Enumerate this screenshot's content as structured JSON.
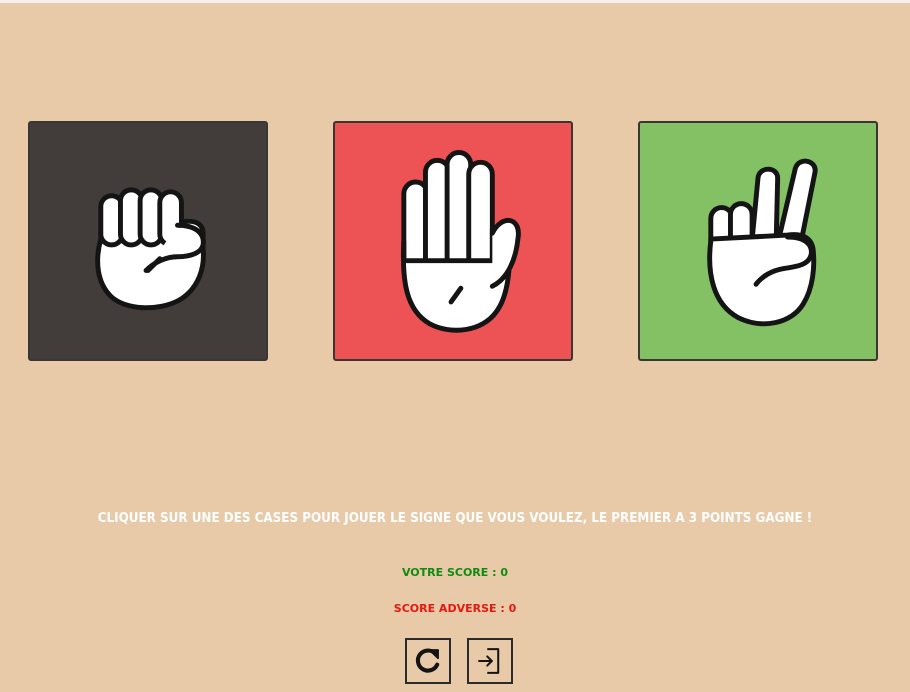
{
  "choices": [
    {
      "name": "rock",
      "icon": "fist-icon",
      "color": "#423d3b"
    },
    {
      "name": "paper",
      "icon": "open-hand-icon",
      "color": "#ed5354"
    },
    {
      "name": "scissors",
      "icon": "peace-sign-icon",
      "color": "#84c064"
    }
  ],
  "instruction": "CLIQUER SUR UNE DES CASES POUR JOUER LE SIGNE QUE VOUS VOULEZ, LE PREMIER A 3 POINTS GAGNE !",
  "score": {
    "player_label": "VOTRE SCORE",
    "player_value": "0",
    "opponent_label": "SCORE ADVERSE",
    "opponent_value": "0",
    "separator": " : "
  },
  "controls": {
    "restart_icon": "restart-icon",
    "exit_icon": "exit-icon"
  },
  "colors": {
    "background": "#e8c9a8",
    "player_score": "#0f8b0f",
    "opponent_score": "#e8170f",
    "instruction": "#ffffff"
  }
}
